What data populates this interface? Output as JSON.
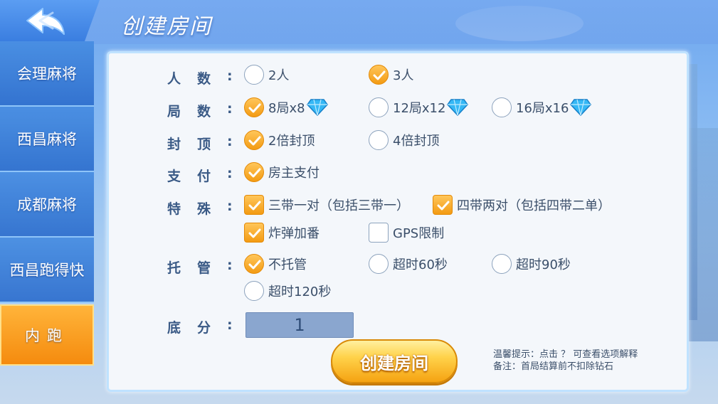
{
  "header": {
    "title": "创建房间",
    "back_icon": "back-arrow-icon"
  },
  "sidebar": {
    "items": [
      {
        "label": "会理麻将",
        "active": false
      },
      {
        "label": "西昌麻将",
        "active": false
      },
      {
        "label": "成都麻将",
        "active": false
      },
      {
        "label": "西昌跑得快",
        "active": false
      },
      {
        "label": "内跑",
        "active": true
      }
    ]
  },
  "form": {
    "players": {
      "label_a": "人",
      "label_b": "数",
      "colon": ":",
      "options": [
        {
          "text": "2人",
          "selected": false
        },
        {
          "text": "3人",
          "selected": true
        }
      ]
    },
    "rounds": {
      "label_a": "局",
      "label_b": "数",
      "colon": ":",
      "options": [
        {
          "text": "8局x8",
          "selected": true,
          "icon": "diamond-icon"
        },
        {
          "text": "12局x12",
          "selected": false,
          "icon": "diamond-icon"
        },
        {
          "text": "16局x16",
          "selected": false,
          "icon": "diamond-icon"
        }
      ]
    },
    "cap": {
      "label_a": "封",
      "label_b": "顶",
      "colon": ":",
      "options": [
        {
          "text": "2倍封顶",
          "selected": true
        },
        {
          "text": "4倍封顶",
          "selected": false
        }
      ]
    },
    "payment": {
      "label_a": "支",
      "label_b": "付",
      "colon": ":",
      "options": [
        {
          "text": "房主支付",
          "selected": true
        }
      ]
    },
    "special": {
      "label_a": "特",
      "label_b": "殊",
      "colon": ":",
      "options": [
        {
          "text": "三带一对（包括三带一）",
          "checked": true
        },
        {
          "text": "四带两对（包括四带二单）",
          "checked": true
        },
        {
          "text": "炸弹加番",
          "checked": true
        },
        {
          "text": "GPS限制",
          "checked": false
        }
      ]
    },
    "hosting": {
      "label_a": "托",
      "label_b": "管",
      "colon": ":",
      "options": [
        {
          "text": "不托管",
          "selected": true
        },
        {
          "text": "超时60秒",
          "selected": false
        },
        {
          "text": "超时90秒",
          "selected": false
        },
        {
          "text": "超时120秒",
          "selected": false
        }
      ]
    },
    "base_score": {
      "label_a": "底",
      "label_b": "分",
      "colon": ":",
      "value": "1"
    }
  },
  "create_button": {
    "label": "创建房间"
  },
  "hints": {
    "line1": "温馨提示：点击 ？ 可查看选项解释",
    "line2": "备注：首局结算前不扣除钻石"
  },
  "colors": {
    "accent": "#f39b13",
    "label": "#3a5a86",
    "sidebar_active": "#f58b0e"
  }
}
